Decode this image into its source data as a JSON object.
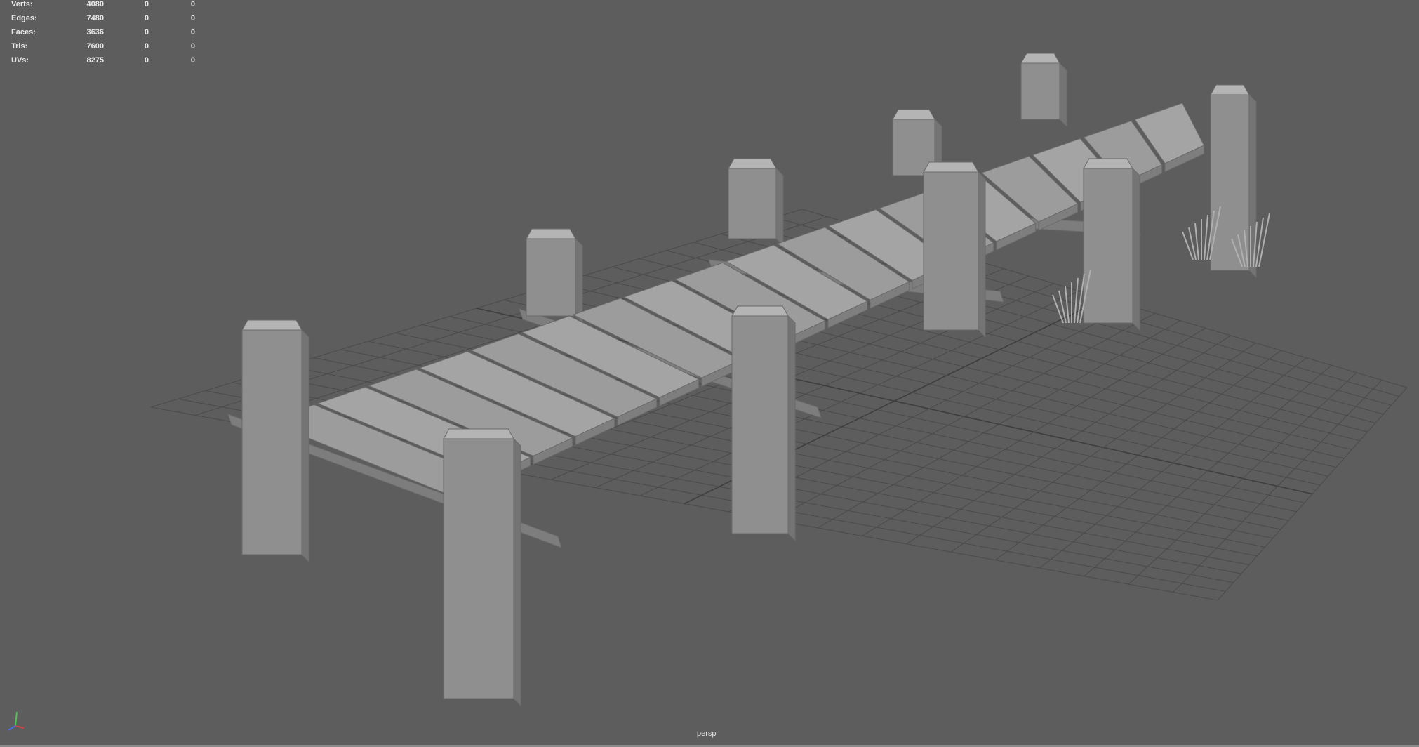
{
  "heads_up_display": {
    "rows": [
      {
        "label": "Verts:",
        "values": [
          "4080",
          "0",
          "0"
        ]
      },
      {
        "label": "Edges:",
        "values": [
          "7480",
          "0",
          "0"
        ]
      },
      {
        "label": "Faces:",
        "values": [
          "3636",
          "0",
          "0"
        ]
      },
      {
        "label": "Tris:",
        "values": [
          "7600",
          "0",
          "0"
        ]
      },
      {
        "label": "UVs:",
        "values": [
          "8275",
          "0",
          "0"
        ]
      }
    ]
  },
  "viewport": {
    "camera_name": "persp",
    "background_color": "#5d5d5d",
    "grid_color": "#4a4a4a",
    "model_color": "#9a9a9a"
  },
  "axis_gizmo": {
    "x_color": "#d24545",
    "y_color": "#52c452",
    "z_color": "#4b6be0",
    "icon": "axis-triad-icon"
  }
}
